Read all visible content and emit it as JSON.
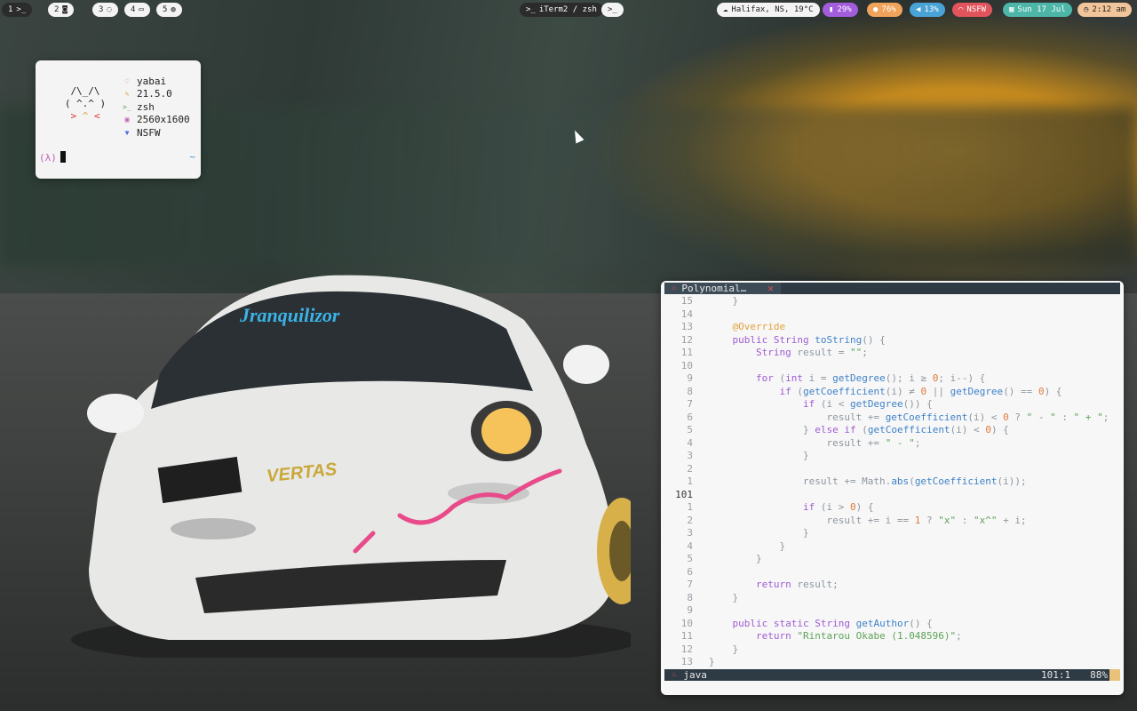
{
  "spaces": [
    {
      "num": "1",
      "icon": ">_"
    },
    {
      "num": "2",
      "icon": "◙"
    },
    {
      "num": "3",
      "icon": "◌"
    },
    {
      "num": "4",
      "icon": "▭"
    },
    {
      "num": "5",
      "icon": "◍"
    }
  ],
  "window_title": "iTerm2 / zsh",
  "window_title_icon": ">_",
  "terminal_chip": ">_",
  "status": {
    "weather": "Halifax, NS, 19°C",
    "battery": "29%",
    "mic": "76%",
    "volume": "13%",
    "wifi": "NSFW",
    "date": "Sun 17 Jul",
    "time": "2:12 am"
  },
  "colors": {
    "battery_bg": "#a35ddc",
    "mic_bg": "#f0a35a",
    "volume_bg": "#4aa3d6",
    "wifi_bg": "#e2545c",
    "date_bg": "#4db6a9",
    "time_bg": "#f1c49a"
  },
  "fetch": {
    "ascii_line1": "/\\_/\\",
    "ascii_line2": "( ^.^ )",
    "ascii_line3_left": ">",
    "ascii_line3_mid": "^",
    "ascii_line3_right": "<",
    "items": [
      {
        "icon": "heart-icon",
        "glyph": "♡",
        "color": "#e2545c",
        "value": "yabai"
      },
      {
        "icon": "wrench-icon",
        "glyph": "✎",
        "color": "#e2a03a",
        "value": "21.5.0"
      },
      {
        "icon": "terminal-icon",
        "glyph": ">_",
        "color": "#5fa35a",
        "value": "zsh"
      },
      {
        "icon": "image-icon",
        "glyph": "▣",
        "color": "#c25db6",
        "value": "2560x1600"
      },
      {
        "icon": "wifi-icon",
        "glyph": "▼",
        "color": "#4a6fd8",
        "value": "NSFW"
      }
    ],
    "prompt_symbol": "(λ)",
    "cwd": "~"
  },
  "editor": {
    "tab_title": "Polynomial…",
    "tab_close": "✕",
    "filetype": "java",
    "position": "101:1",
    "percent": "88%",
    "lines": [
      {
        "n": "15",
        "code": "    }"
      },
      {
        "n": "14",
        "code": ""
      },
      {
        "n": "13",
        "code": "    @Override"
      },
      {
        "n": "12",
        "code": "    public String toString() {"
      },
      {
        "n": "11",
        "code": "        String result = \"\";"
      },
      {
        "n": "10",
        "code": ""
      },
      {
        "n": "9",
        "code": "        for (int i = getDegree(); i ≥ 0; i--) {"
      },
      {
        "n": "8",
        "code": "            if (getCoefficient(i) ≠ 0 || getDegree() == 0) {"
      },
      {
        "n": "7",
        "code": "                if (i < getDegree()) {"
      },
      {
        "n": "6",
        "code": "                    result += getCoefficient(i) < 0 ? \" - \" : \" + \";"
      },
      {
        "n": "5",
        "code": "                } else if (getCoefficient(i) < 0) {"
      },
      {
        "n": "4",
        "code": "                    result += \" - \";"
      },
      {
        "n": "3",
        "code": "                }"
      },
      {
        "n": "2",
        "code": ""
      },
      {
        "n": "1",
        "code": "                result += Math.abs(getCoefficient(i));"
      },
      {
        "n": "101",
        "code": ""
      },
      {
        "n": "1",
        "code": "                if (i > 0) {"
      },
      {
        "n": "2",
        "code": "                    result += i == 1 ? \"x\" : \"x^\" + i;"
      },
      {
        "n": "3",
        "code": "                }"
      },
      {
        "n": "4",
        "code": "            }"
      },
      {
        "n": "5",
        "code": "        }"
      },
      {
        "n": "6",
        "code": ""
      },
      {
        "n": "7",
        "code": "        return result;"
      },
      {
        "n": "8",
        "code": "    }"
      },
      {
        "n": "9",
        "code": ""
      },
      {
        "n": "10",
        "code": "    public static String getAuthor() {"
      },
      {
        "n": "11",
        "code": "        return \"Rintarou Okabe (1.048596)\";"
      },
      {
        "n": "12",
        "code": "    }"
      },
      {
        "n": "13",
        "code": "}"
      }
    ]
  }
}
